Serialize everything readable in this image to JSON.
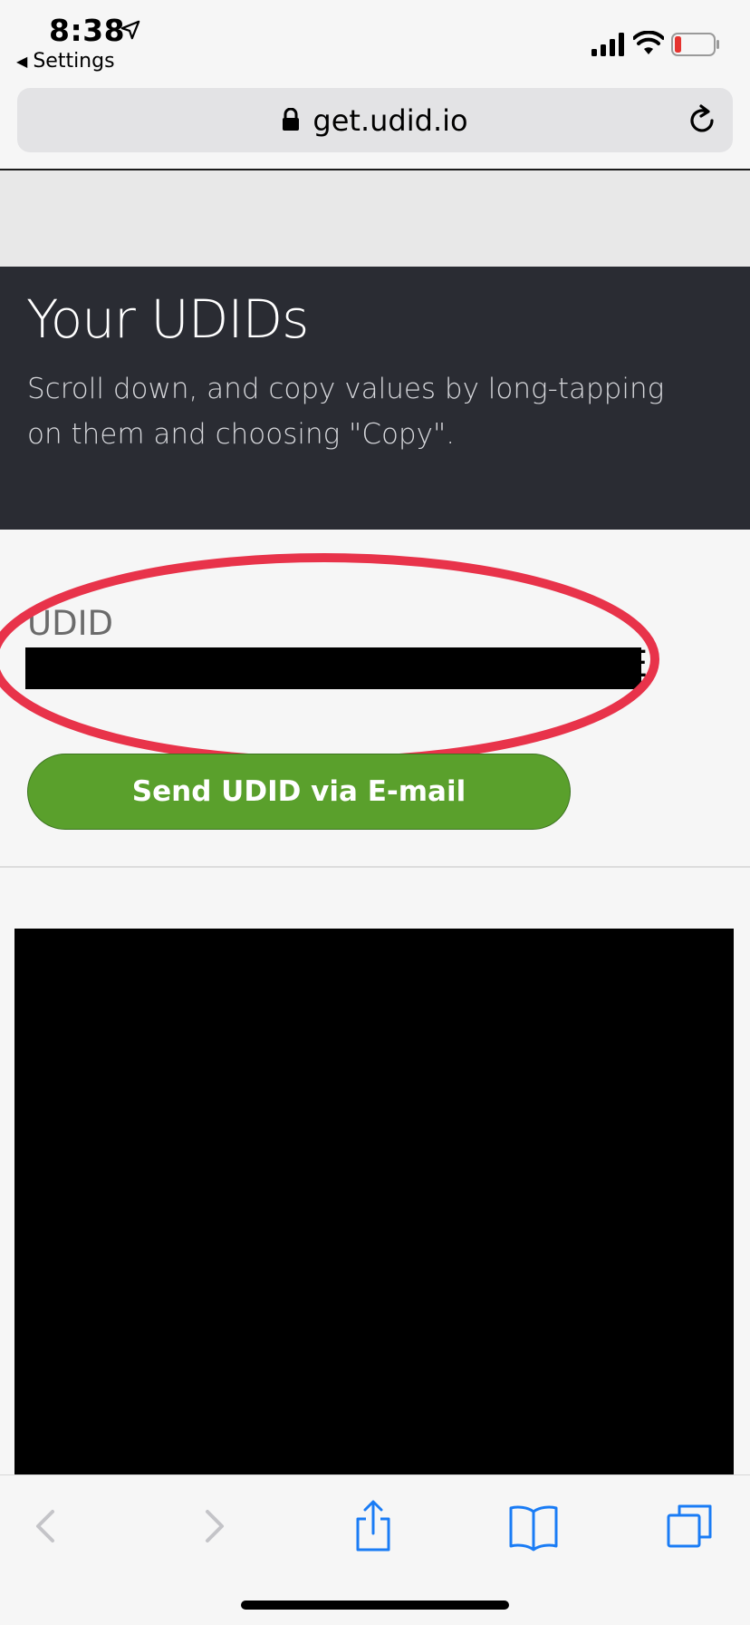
{
  "status_bar": {
    "time": "8:38",
    "back_app": "Settings"
  },
  "url_bar": {
    "url": "get.udid.io"
  },
  "hero": {
    "title": "Your UDIDs",
    "subtitle": "Scroll down, and copy values by long-tapping on them and choosing \"Copy\"."
  },
  "udid": {
    "label": "UDID",
    "value_tail": "E"
  },
  "send_button": {
    "label": "Send UDID via E-mail"
  },
  "colors": {
    "hero_bg": "#2a2c33",
    "button_green": "#5aa02c",
    "highlight_red": "#e8334a",
    "toolbar_icon_blue": "#1a7cf5"
  },
  "toolbar": {
    "icons": [
      "back-icon",
      "forward-icon",
      "share-icon",
      "bookmarks-icon",
      "tabs-icon"
    ]
  }
}
